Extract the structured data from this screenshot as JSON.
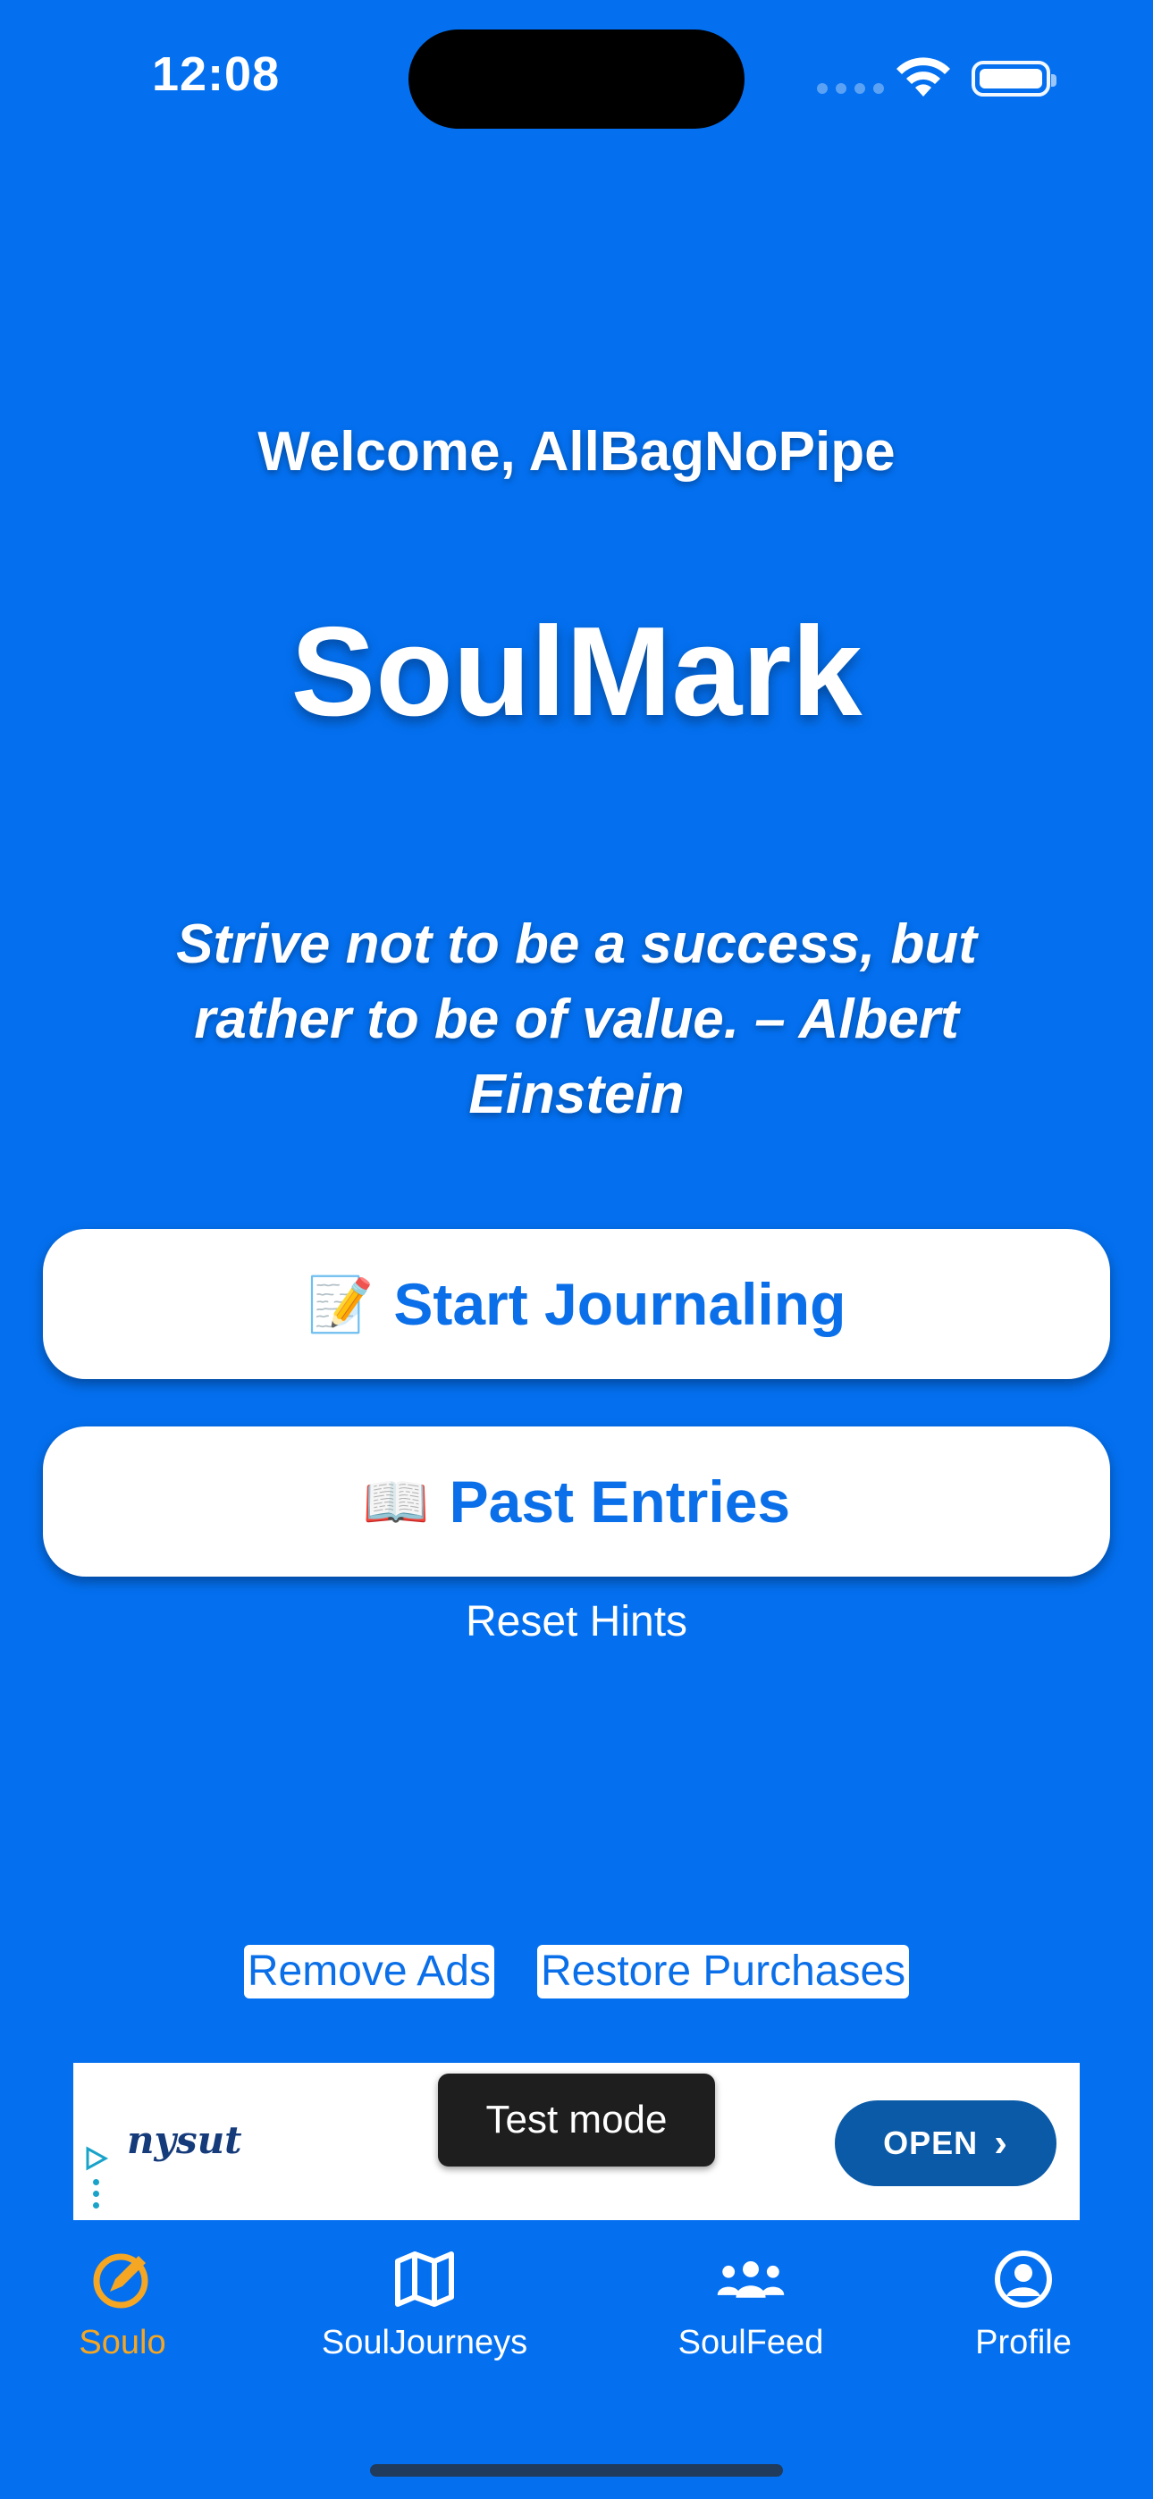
{
  "status_bar": {
    "time": "12:08"
  },
  "main": {
    "welcome": "Welcome, AllBagNoPipe",
    "app_title": "SoulMark",
    "quote": "Strive not to be a success, but rather to be of value. – Albert Einstein",
    "start_button": {
      "emoji": "📝",
      "label": "Start Journaling"
    },
    "past_button": {
      "emoji": "📖",
      "label": "Past Entries"
    },
    "reset_hints": "Reset Hints",
    "remove_ads": "Remove Ads",
    "restore_purchases": "Restore Purchases"
  },
  "ad": {
    "logo_text": "nysut",
    "test_mode": "Test mode",
    "open_label": "OPEN"
  },
  "tabbar": {
    "items": [
      {
        "label": "Soulo",
        "icon": "soulo-compass-icon",
        "active": true
      },
      {
        "label": "SoulJourneys",
        "icon": "map-icon",
        "active": false
      },
      {
        "label": "SoulFeed",
        "icon": "people-icon",
        "active": false
      },
      {
        "label": "Profile",
        "icon": "person-circle-icon",
        "active": false
      }
    ]
  },
  "colors": {
    "background": "#0470F0",
    "button_text": "#0A6FE8",
    "active_tab": "#F5A623",
    "ad_open_button": "#0A5AA8"
  }
}
